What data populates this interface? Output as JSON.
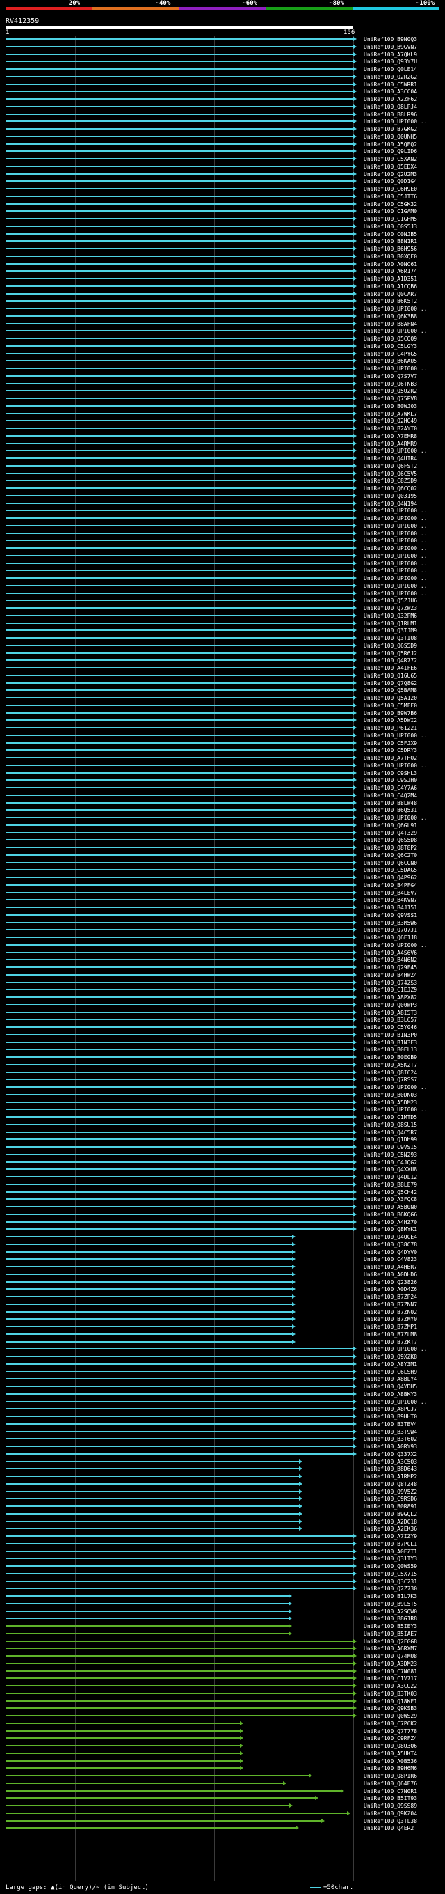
{
  "legend": {
    "labels": [
      "20%",
      "~40%",
      "~60%",
      "~80%",
      "~100%"
    ],
    "colors": [
      "#e02020",
      "#e07020",
      "#9020c0",
      "#18a018",
      "#20c8e0"
    ]
  },
  "query": {
    "name": "RV412359",
    "start": "1",
    "end": "156"
  },
  "colors": {
    "identity_high": "#4fd3e4",
    "identity_mid": "#5fb32a"
  },
  "hits": [
    {
      "label": "UniRef100_B9N0Q3"
    },
    {
      "label": "UniRef100_B9GVN7"
    },
    {
      "label": "UniRef100_A7QKL9"
    },
    {
      "label": "UniRef100_Q93Y7U"
    },
    {
      "label": "UniRef100_Q0LE14"
    },
    {
      "label": "UniRef100_Q2R2G2"
    },
    {
      "label": "UniRef100_C5WRR1"
    },
    {
      "label": "UniRef100_A3CC0A"
    },
    {
      "label": "UniRef100_A2ZF62"
    },
    {
      "label": "UniRef100_Q8LPJ4"
    },
    {
      "label": "UniRef100_B8LR96"
    },
    {
      "label": "UniRef100_UPI000..."
    },
    {
      "label": "UniRef100_B7GKG2"
    },
    {
      "label": "UniRef100_Q0UNH5"
    },
    {
      "label": "UniRef100_A5QEQ2"
    },
    {
      "label": "UniRef100_Q9LID6"
    },
    {
      "label": "UniRef100_C5XAN2"
    },
    {
      "label": "UniRef100_Q5EDX4"
    },
    {
      "label": "UniRef100_Q2U2M3"
    },
    {
      "label": "UniRef100_Q0D1G4"
    },
    {
      "label": "UniRef100_C6H9E0"
    },
    {
      "label": "UniRef100_C5JTT6"
    },
    {
      "label": "UniRef100_C5GK32"
    },
    {
      "label": "UniRef100_C1GAM0"
    },
    {
      "label": "UniRef100_C1GHM5"
    },
    {
      "label": "UniRef100_C0S5J3"
    },
    {
      "label": "UniRef100_C0NJB5"
    },
    {
      "label": "UniRef100_B8N1R1"
    },
    {
      "label": "UniRef100_B6H956"
    },
    {
      "label": "UniRef100_B0XQF0"
    },
    {
      "label": "UniRef100_A0NC61"
    },
    {
      "label": "UniRef100_A6R174"
    },
    {
      "label": "UniRef100_A1D351"
    },
    {
      "label": "UniRef100_A1CQB6"
    },
    {
      "label": "UniRef100_Q0CAR7"
    },
    {
      "label": "UniRef100_B6K5T2"
    },
    {
      "label": "UniRef100_UPI000..."
    },
    {
      "label": "UniRef100_Q6K3B8"
    },
    {
      "label": "UniRef100_B8AFN4"
    },
    {
      "label": "UniRef100_UPI000..."
    },
    {
      "label": "UniRef100_Q5CQQ9"
    },
    {
      "label": "UniRef100_C5LGY3"
    },
    {
      "label": "UniRef100_C4PYG5"
    },
    {
      "label": "UniRef100_B6KAU5"
    },
    {
      "label": "UniRef100_UPI000..."
    },
    {
      "label": "UniRef100_Q7S7V7"
    },
    {
      "label": "UniRef100_Q6TNB3"
    },
    {
      "label": "UniRef100_Q5U2R2"
    },
    {
      "label": "UniRef100_Q75PV8"
    },
    {
      "label": "UniRef100_B0WJ03"
    },
    {
      "label": "UniRef100_A7WKL7"
    },
    {
      "label": "UniRef100_Q2HG49"
    },
    {
      "label": "UniRef100_B2AYT0"
    },
    {
      "label": "UniRef100_A7EMR8"
    },
    {
      "label": "UniRef100_A4RMR9"
    },
    {
      "label": "UniRef100_UPI000..."
    },
    {
      "label": "UniRef100_Q4UIR4"
    },
    {
      "label": "UniRef100_Q6FST2"
    },
    {
      "label": "UniRef100_Q6C5V5"
    },
    {
      "label": "UniRef100_C8Z5D9"
    },
    {
      "label": "UniRef100_Q6CQ02"
    },
    {
      "label": "UniRef100_Q03195"
    },
    {
      "label": "UniRef100_Q4N194"
    },
    {
      "label": "UniRef100_UPI000..."
    },
    {
      "label": "UniRef100_UPI000..."
    },
    {
      "label": "UniRef100_UPI000..."
    },
    {
      "label": "UniRef100_UPI000..."
    },
    {
      "label": "UniRef100_UPI000..."
    },
    {
      "label": "UniRef100_UPI000..."
    },
    {
      "label": "UniRef100_UPI000..."
    },
    {
      "label": "UniRef100_UPI000..."
    },
    {
      "label": "UniRef100_UPI000..."
    },
    {
      "label": "UniRef100_UPI000..."
    },
    {
      "label": "UniRef100_UPI000..."
    },
    {
      "label": "UniRef100_UPI000..."
    },
    {
      "label": "UniRef100_Q5ZJU6"
    },
    {
      "label": "UniRef100_Q7ZWZ3"
    },
    {
      "label": "UniRef100_Q32PM6"
    },
    {
      "label": "UniRef100_Q1RLM1"
    },
    {
      "label": "UniRef100_Q3TJM9"
    },
    {
      "label": "UniRef100_Q3TIU8"
    },
    {
      "label": "UniRef100_Q6S5D9"
    },
    {
      "label": "UniRef100_Q5R6J2"
    },
    {
      "label": "UniRef100_Q4R772"
    },
    {
      "label": "UniRef100_A4IFE6"
    },
    {
      "label": "UniRef100_Q16U65"
    },
    {
      "label": "UniRef100_Q7Q8G2"
    },
    {
      "label": "UniRef100_Q5BAM8"
    },
    {
      "label": "UniRef100_Q5A120"
    },
    {
      "label": "UniRef100_C5MFF0"
    },
    {
      "label": "UniRef100_B9W7B6"
    },
    {
      "label": "UniRef100_A5DWI2"
    },
    {
      "label": "UniRef100_P61221"
    },
    {
      "label": "UniRef100_UPI000..."
    },
    {
      "label": "UniRef100_C5FJX9"
    },
    {
      "label": "UniRef100_C5DRY3"
    },
    {
      "label": "UniRef100_A7THO2"
    },
    {
      "label": "UniRef100_UPI000..."
    },
    {
      "label": "UniRef100_C9SHL3"
    },
    {
      "label": "UniRef100_C9SJH0"
    },
    {
      "label": "UniRef100_C4Y7A6"
    },
    {
      "label": "UniRef100_C4Q2M4"
    },
    {
      "label": "UniRef100_B8LW48"
    },
    {
      "label": "UniRef100_B6Q531"
    },
    {
      "label": "UniRef100_UPI000..."
    },
    {
      "label": "UniRef100_Q6GL91"
    },
    {
      "label": "UniRef100_Q4T329"
    },
    {
      "label": "UniRef100_Q6S5D8"
    },
    {
      "label": "UniRef100_Q8T8P2"
    },
    {
      "label": "UniRef100_Q6C2T0"
    },
    {
      "label": "UniRef100_Q6CGN0"
    },
    {
      "label": "UniRef100_C5DAG5"
    },
    {
      "label": "UniRef100_Q4P962"
    },
    {
      "label": "UniRef100_B4PFG4"
    },
    {
      "label": "UniRef100_B4LEV7"
    },
    {
      "label": "UniRef100_B4KVN7"
    },
    {
      "label": "UniRef100_B4J151"
    },
    {
      "label": "UniRef100_Q9VSS1"
    },
    {
      "label": "UniRef100_B3M5W6"
    },
    {
      "label": "UniRef100_Q7Q7J1"
    },
    {
      "label": "UniRef100_Q6E1J8"
    },
    {
      "label": "UniRef100_UPI000..."
    },
    {
      "label": "UniRef100_A4S6V6"
    },
    {
      "label": "UniRef100_B4N6N2"
    },
    {
      "label": "UniRef100_Q29F45"
    },
    {
      "label": "UniRef100_B4HWZ4"
    },
    {
      "label": "UniRef100_Q74ZS3"
    },
    {
      "label": "UniRef100_C1EJZ9"
    },
    {
      "label": "UniRef100_A8PX82"
    },
    {
      "label": "UniRef100_Q00WP3"
    },
    {
      "label": "UniRef100_A8I5T3"
    },
    {
      "label": "UniRef100_B3L657"
    },
    {
      "label": "UniRef100_C5Y046"
    },
    {
      "label": "UniRef100_B1N3P0"
    },
    {
      "label": "UniRef100_B1N3F3"
    },
    {
      "label": "UniRef100_B0EL13"
    },
    {
      "label": "UniRef100_B0E0B9"
    },
    {
      "label": "UniRef100_A5K2T7"
    },
    {
      "label": "UniRef100_Q8I624"
    },
    {
      "label": "UniRef100_Q7RSS7"
    },
    {
      "label": "UniRef100_UPI000..."
    },
    {
      "label": "UniRef100_B0DN03"
    },
    {
      "label": "UniRef100_A5DM23"
    },
    {
      "label": "UniRef100_UPI000..."
    },
    {
      "label": "UniRef100_C1MTD5"
    },
    {
      "label": "UniRef100_Q8SU15"
    },
    {
      "label": "UniRef100_Q4C5R7"
    },
    {
      "label": "UniRef100_Q1DH99"
    },
    {
      "label": "UniRef100_C9VSI5"
    },
    {
      "label": "UniRef100_C5N293"
    },
    {
      "label": "UniRef100_C4JQG2"
    },
    {
      "label": "UniRef100_Q4XXU8"
    },
    {
      "label": "UniRef100_Q4DL12"
    },
    {
      "label": "UniRef100_B8LE79"
    },
    {
      "label": "UniRef100_Q5CH42"
    },
    {
      "label": "UniRef100_A3FQC8"
    },
    {
      "label": "UniRef100_A5B0N0"
    },
    {
      "label": "UniRef100_B6KQG6"
    },
    {
      "label": "UniRef100_A4HZ70"
    },
    {
      "label": "UniRef100_Q8MYK1"
    },
    {
      "label": "UniRef100_Q4QCE4"
    },
    {
      "label": "UniRef100_Q38C78"
    },
    {
      "label": "UniRef100_Q4DYV0"
    },
    {
      "label": "UniRef100_C4V823"
    },
    {
      "label": "UniRef100_A4HBR7"
    },
    {
      "label": "UniRef100_A0DHD6"
    },
    {
      "label": "UniRef100_Q23826"
    },
    {
      "label": "UniRef100_A0D4Z6"
    },
    {
      "label": "UniRef100_B7ZP24"
    },
    {
      "label": "UniRef100_B7ZNN7"
    },
    {
      "label": "UniRef100_B7ZN02"
    },
    {
      "label": "UniRef100_B7ZMY0"
    },
    {
      "label": "UniRef100_B7ZMP1"
    },
    {
      "label": "UniRef100_B7ZLM8"
    },
    {
      "label": "UniRef100_B7ZKT7"
    },
    {
      "label": "UniRef100_UPI000..."
    },
    {
      "label": "UniRef100_Q9XZK8"
    },
    {
      "label": "UniRef100_A8Y3M1"
    },
    {
      "label": "UniRef100_C6LSH9"
    },
    {
      "label": "UniRef100_A8BLY4"
    },
    {
      "label": "UniRef100_Q4YDH5"
    },
    {
      "label": "UniRef100_A8BKY3"
    },
    {
      "label": "UniRef100_UPI000..."
    },
    {
      "label": "UniRef100_A8PUJ7"
    },
    {
      "label": "UniRef100_B9HHT0"
    },
    {
      "label": "UniRef100_B3TBV4"
    },
    {
      "label": "UniRef100_B3T9W4"
    },
    {
      "label": "UniRef100_B3T602"
    },
    {
      "label": "UniRef100_A0RY93"
    },
    {
      "label": "UniRef100_Q337X2"
    },
    {
      "label": "UniRef100_A3C5Q3"
    },
    {
      "label": "UniRef100_B8D643"
    },
    {
      "label": "UniRef100_A1RMP2"
    },
    {
      "label": "UniRef100_Q8TZ48"
    },
    {
      "label": "UniRef100_Q9V5Z2"
    },
    {
      "label": "UniRef100_C9RSD6"
    },
    {
      "label": "UniRef100_B0R891"
    },
    {
      "label": "UniRef100_B9GQL2"
    },
    {
      "label": "UniRef100_A2DC18"
    },
    {
      "label": "UniRef100_A2EK36"
    },
    {
      "label": "UniRef100_A7IZY9"
    },
    {
      "label": "UniRef100_B7PCL1"
    },
    {
      "label": "UniRef100_A0EZT1"
    },
    {
      "label": "UniRef100_Q31TY3"
    },
    {
      "label": "UniRef100_Q0WS59"
    },
    {
      "label": "UniRef100_C5X715"
    },
    {
      "label": "UniRef100_Q3C231"
    },
    {
      "label": "UniRef100_Q2Z730"
    },
    {
      "label": "UniRef100_B1L7K3"
    },
    {
      "label": "UniRef100_B9L5T5"
    },
    {
      "label": "UniRef100_A2SQW0"
    },
    {
      "label": "UniRef100_B8G1R8"
    },
    {
      "label": "UniRef100_B5IEY3"
    },
    {
      "label": "UniRef100_B5IAE7"
    },
    {
      "label": "UniRef100_Q2FGG8"
    },
    {
      "label": "UniRef100_A6RXM7"
    },
    {
      "label": "UniRef100_Q74MU8"
    },
    {
      "label": "UniRef100_A3DM23"
    },
    {
      "label": "UniRef100_C7N081"
    },
    {
      "label": "UniRef100_C1V717"
    },
    {
      "label": "UniRef100_A3CU22"
    },
    {
      "label": "UniRef100_B3TK03"
    },
    {
      "label": "UniRef100_Q18KF1"
    },
    {
      "label": "UniRef100_Q9KSB3"
    },
    {
      "label": "UniRef100_Q0WS29"
    },
    {
      "label": "UniRef100_C7P6K2"
    },
    {
      "label": "UniRef100_Q7T778"
    },
    {
      "label": "UniRef100_C9RFZ4"
    },
    {
      "label": "UniRef100_Q8U3Q6"
    },
    {
      "label": "UniRef100_A5UKT4"
    },
    {
      "label": "UniRef100_A0B536"
    },
    {
      "label": "UniRef100_B9H6M6"
    },
    {
      "label": "UniRef100_Q8PIR6"
    },
    {
      "label": "UniRef100_Q64E76"
    },
    {
      "label": "UniRef100_C7N0R1"
    },
    {
      "label": "UniRef100_B5IT93"
    },
    {
      "label": "UniRef100_Q9SS89"
    },
    {
      "label": "UniRef100_Q9KZ04"
    },
    {
      "label": "UniRef100_Q3TL38"
    },
    {
      "label": "UniRef100_Q4ER2"
    }
  ],
  "footer": {
    "gaps": "Large gaps: ▲(in Query)/~ (in Subject)",
    "scale": "=50char."
  }
}
